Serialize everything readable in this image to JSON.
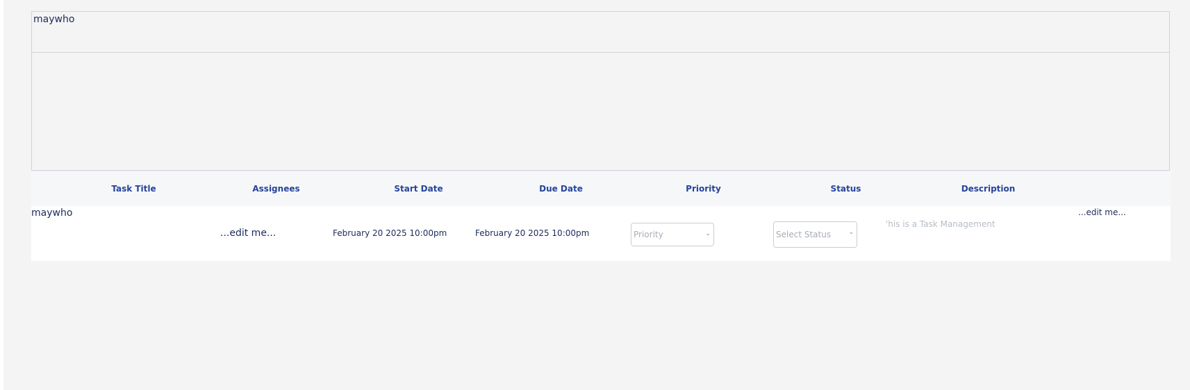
{
  "task_editor": {
    "title": "maywho"
  },
  "table": {
    "headers": [
      "Task Title",
      "Assignees",
      "Start Date",
      "Due Date",
      "Priority",
      "Status",
      "Description"
    ],
    "row": {
      "title": "maywho",
      "assignees": "...edit me...",
      "start_date": "February 20 2025 10:00pm",
      "due_date": "February 20 2025 10:00pm",
      "priority_placeholder": "Priority",
      "status_placeholder": "Select Status",
      "description": "'his is a Task Management",
      "edit_label": "...edit me..."
    }
  }
}
